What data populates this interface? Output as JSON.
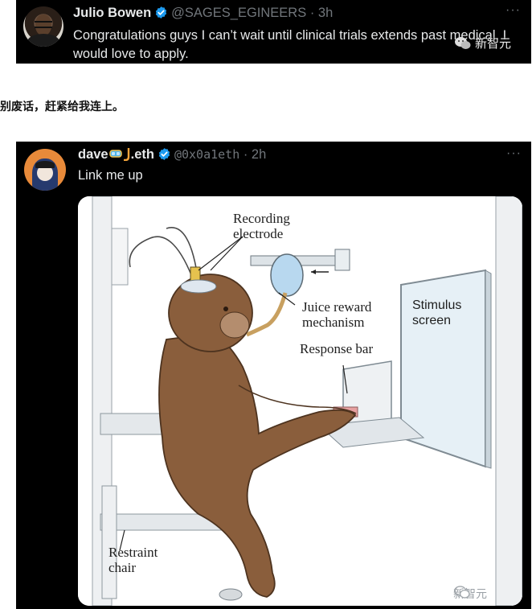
{
  "tweet1": {
    "display_name": "Julio Bowen",
    "handle": "@SAGES_EGINEERS",
    "time": "3h",
    "text": "Congratulations guys I can’t wait until clinical trials extends past medical. I would love to apply.",
    "more_icon": "more-horizontal-icon",
    "watermark": "新智元"
  },
  "caption": "别废话，赶紧给我连上。",
  "tweet2": {
    "display_name_prefix": "dave",
    "display_name_suffix": ".eth",
    "handle": "@0x0a1eth",
    "time": "2h",
    "text": "Link me up",
    "more_icon": "more-horizontal-icon",
    "media": {
      "labels": {
        "recording": "Recording\nelectrode",
        "juice": "Juice reward\nmechanism",
        "stimulus": "Stimulus\nscreen",
        "response": "Response bar",
        "restraint": "Restraint\nchair"
      }
    },
    "watermark": "新智元"
  },
  "colors": {
    "tweet_bg": "#000000",
    "text": "#e7e9ea",
    "muted": "#71767b",
    "verified": "#1d9bf0"
  }
}
